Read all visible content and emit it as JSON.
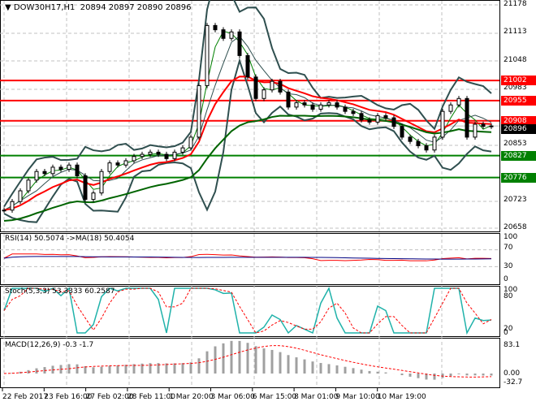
{
  "header": {
    "symbol": "DOW30H17,H1",
    "ohlc": "20894 20897 20890 20896"
  },
  "price_axis": [
    "21178",
    "21113",
    "21048",
    "20983",
    "20853",
    "20723",
    "20658"
  ],
  "levels": [
    {
      "price": 21002,
      "label": "21002",
      "color": "#ff0000"
    },
    {
      "price": 20955,
      "label": "20955",
      "color": "#ff0000"
    },
    {
      "price": 20908,
      "label": "20908",
      "color": "#ff0000"
    },
    {
      "price": 20827,
      "label": "20827",
      "color": "#008000"
    },
    {
      "price": 20776,
      "label": "20776",
      "color": "#008000"
    }
  ],
  "current_price": {
    "price": 20896,
    "label": "20896"
  },
  "rsi": {
    "title": "RSI(14) 50.5074  ->MA(18) 50.4054",
    "axis": [
      "100",
      "70",
      "30",
      "0"
    ]
  },
  "stoch": {
    "title": "Stoch(5,3,3) 53.3333 60.2587",
    "axis": [
      "100",
      "80",
      "20",
      "0"
    ]
  },
  "macd": {
    "title": "MACD(12,26,9) -0.3 -1.7",
    "axis": [
      "83.1",
      "0.00",
      "-32.7"
    ]
  },
  "time_axis": [
    "22 Feb 2017",
    "23 Feb 16:00",
    "27 Feb 02:00",
    "28 Feb 11:00",
    "1 Mar 20:00",
    "3 Mar 06:00",
    "6 Mar 15:00",
    "8 Mar 01:00",
    "9 Mar 10:00",
    "10 Mar 19:00"
  ],
  "chart_data": {
    "type": "line",
    "title": "DOW30H17,H1",
    "ylim": [
      20658,
      21178
    ],
    "closes": [
      20700,
      20720,
      20745,
      20770,
      20790,
      20785,
      20800,
      20795,
      20805,
      20780,
      20725,
      20740,
      20790,
      20810,
      20805,
      20815,
      20825,
      20830,
      20835,
      20830,
      20820,
      20835,
      20845,
      20870,
      20990,
      21130,
      21120,
      21100,
      21115,
      21060,
      21010,
      20960,
      20980,
      21000,
      20975,
      20940,
      20950,
      20945,
      20935,
      20945,
      20950,
      20940,
      20930,
      20925,
      20910,
      20905,
      20920,
      20915,
      20895,
      20870,
      20860,
      20850,
      20840,
      20870,
      20930,
      20945,
      20960,
      20870,
      20900,
      20895,
      20896
    ]
  }
}
